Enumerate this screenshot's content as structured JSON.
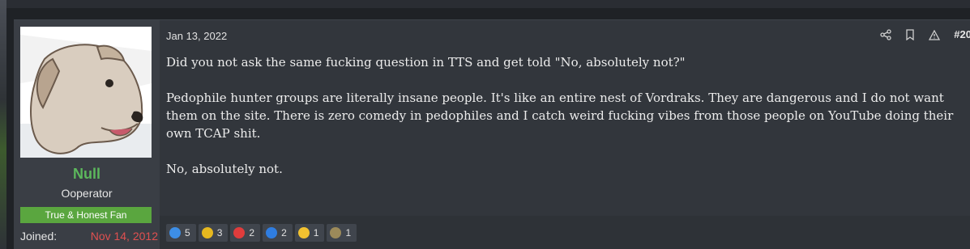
{
  "post": {
    "date": "Jan 13, 2022",
    "number": "#20",
    "paragraphs": [
      "Did you not ask the same fucking question in TTS and get told \"No, absolutely not?\"",
      "Pedophile hunter groups are literally insane people. It's like an entire nest of Vordraks. They are dangerous and I do not want them on the site. There is zero comedy in pedophiles and I catch weird fucking vibes from those people on YouTube doing their own TCAP shit.",
      "No, absolutely not."
    ]
  },
  "user": {
    "name": "Null",
    "title": "Ooperator",
    "banner": "True & Honest Fan",
    "joined_label": "Joined:",
    "joined_value": "Nov 14, 2012"
  },
  "tools": [
    "share-icon",
    "bookmark-icon",
    "report-icon"
  ],
  "reactions": [
    {
      "icon": "thumbs-up-icon",
      "count": "5",
      "color": "#3d8ee6"
    },
    {
      "icon": "medal-icon",
      "count": "3",
      "color": "#e6b81f"
    },
    {
      "icon": "heart-icon",
      "count": "2",
      "color": "#e03c3c"
    },
    {
      "icon": "info-icon",
      "count": "2",
      "color": "#2f7de0"
    },
    {
      "icon": "thinking-face-icon",
      "count": "1",
      "color": "#f2c230"
    },
    {
      "icon": "salute-icon",
      "count": "1",
      "color": "#9c8a5a"
    }
  ],
  "colors": {
    "username": "#5cb85c",
    "banner": "#5aa63f",
    "joined_value": "#e05050",
    "post_bg": "#32363c",
    "user_pane_bg": "#3a3e45"
  }
}
